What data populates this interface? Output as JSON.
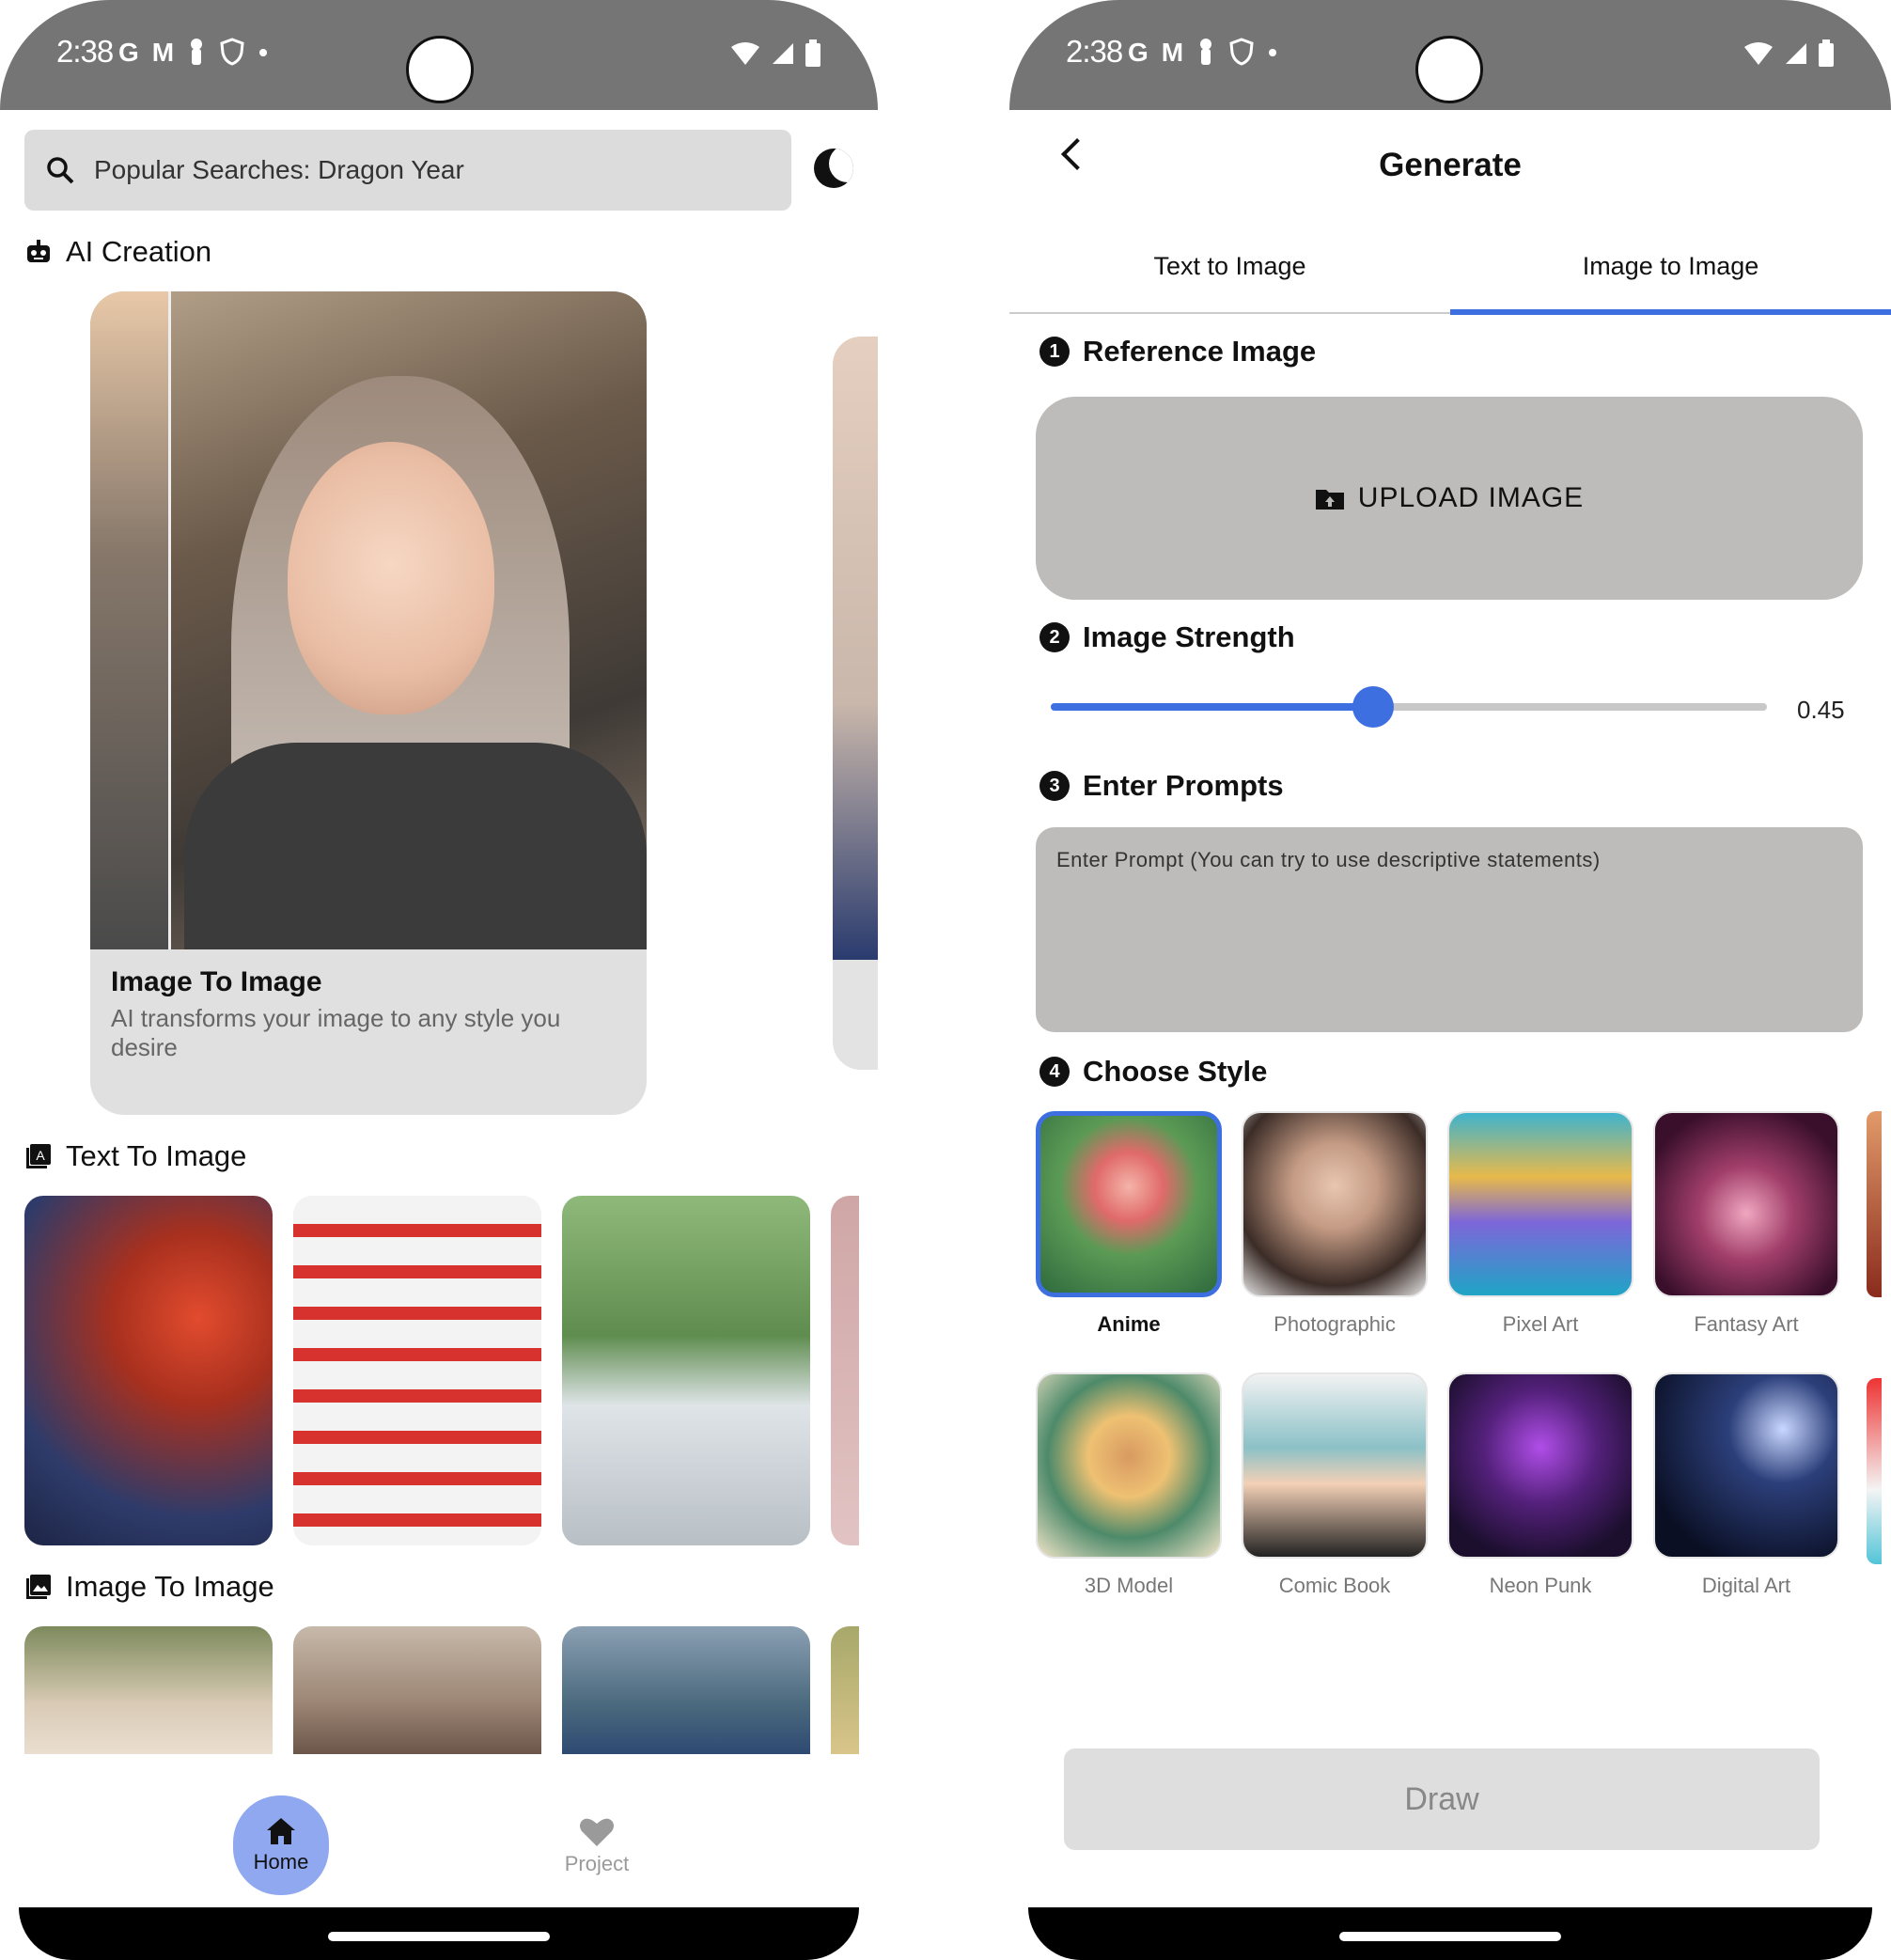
{
  "status_bar": {
    "time": "2:38",
    "left_icons": [
      "G",
      "M",
      "person-icon",
      "shield-icon",
      "•"
    ]
  },
  "left": {
    "search_placeholder": "Popular Searches: Dragon Year",
    "section_ai_creation": "AI Creation",
    "feature_card": {
      "title": "Image To Image",
      "description": "AI transforms your image to any style you desire"
    },
    "section_text_to_image": "Text To Image",
    "section_image_to_image": "Image To Image",
    "nav": {
      "home": "Home",
      "project": "Project"
    }
  },
  "right": {
    "title": "Generate",
    "tabs": [
      {
        "label": "Text to Image",
        "active": false
      },
      {
        "label": "Image to Image",
        "active": true
      }
    ],
    "steps": {
      "s1": {
        "num": "1",
        "label": "Reference Image"
      },
      "s2": {
        "num": "2",
        "label": "Image Strength"
      },
      "s3": {
        "num": "3",
        "label": "Enter Prompts"
      },
      "s4": {
        "num": "4",
        "label": "Choose Style"
      }
    },
    "upload_label": "UPLOAD IMAGE",
    "strength_value": "0.45",
    "strength": 0.45,
    "prompt_placeholder": "Enter Prompt (You can try to use descriptive statements)",
    "styles": [
      {
        "label": "Anime",
        "selected": true
      },
      {
        "label": "Photographic",
        "selected": false
      },
      {
        "label": "Pixel Art",
        "selected": false
      },
      {
        "label": "Fantasy Art",
        "selected": false
      },
      {
        "label": "3D Model",
        "selected": false
      },
      {
        "label": "Comic Book",
        "selected": false
      },
      {
        "label": "Neon Punk",
        "selected": false
      },
      {
        "label": "Digital Art",
        "selected": false
      }
    ],
    "draw_label": "Draw"
  },
  "colors": {
    "accent": "#3d6fe0",
    "nav_active": "#8fa8f0",
    "status_bar": "#757575",
    "field_bg": "#bdbcba"
  }
}
